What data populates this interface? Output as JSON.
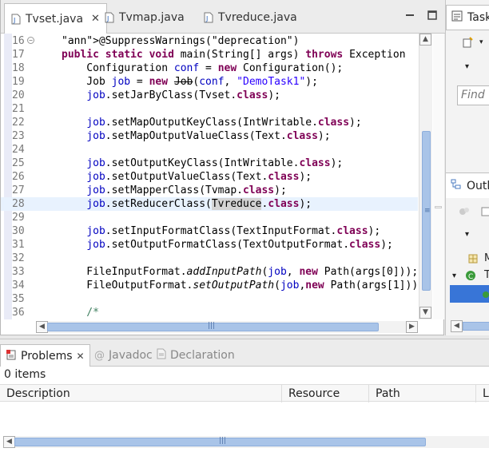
{
  "editor": {
    "tabs": [
      {
        "label": "Tvset.java",
        "active": true,
        "closable": true
      },
      {
        "label": "Tvmap.java",
        "active": false
      },
      {
        "label": "Tvreduce.java",
        "active": false
      }
    ],
    "lines": [
      {
        "n": "16",
        "text": "@SuppressWarnings(\"deprecation\")"
      },
      {
        "n": "17",
        "text": "public static void main(String[] args) throws Exception"
      },
      {
        "n": "18",
        "text": "    Configuration conf = new Configuration();"
      },
      {
        "n": "19",
        "text": "    Job job = new Job(conf, \"DemoTask1\");"
      },
      {
        "n": "20",
        "text": "    job.setJarByClass(Tvset.class);"
      },
      {
        "n": "21",
        "text": ""
      },
      {
        "n": "22",
        "text": "    job.setMapOutputKeyClass(IntWritable.class);"
      },
      {
        "n": "23",
        "text": "    job.setMapOutputValueClass(Text.class);"
      },
      {
        "n": "24",
        "text": ""
      },
      {
        "n": "25",
        "text": "    job.setOutputKeyClass(IntWritable.class);"
      },
      {
        "n": "26",
        "text": "    job.setOutputValueClass(Text.class);"
      },
      {
        "n": "27",
        "text": "    job.setMapperClass(Tvmap.class);"
      },
      {
        "n": "28",
        "text": "    job.setReducerClass(Tvreduce.class);"
      },
      {
        "n": "29",
        "text": ""
      },
      {
        "n": "30",
        "text": "    job.setInputFormatClass(TextInputFormat.class);"
      },
      {
        "n": "31",
        "text": "    job.setOutputFormatClass(TextOutputFormat.class);"
      },
      {
        "n": "32",
        "text": ""
      },
      {
        "n": "33",
        "text": "    FileInputFormat.addInputPath(job, new Path(args[0]));"
      },
      {
        "n": "34",
        "text": "    FileOutputFormat.setOutputPath(job,new Path(args[1]));"
      },
      {
        "n": "35",
        "text": ""
      },
      {
        "n": "36",
        "text": "    /*"
      }
    ],
    "current_line": "28"
  },
  "right": {
    "task_title": "Task",
    "find_placeholder": "Find",
    "outline_title": "Outl",
    "outline_items": [
      "M",
      "T"
    ]
  },
  "bottom": {
    "tabs": [
      {
        "label": "Problems",
        "active": true
      },
      {
        "label": "Javadoc",
        "active": false
      },
      {
        "label": "Declaration",
        "active": false
      }
    ],
    "items_count": "0 items",
    "columns": [
      "Description",
      "Resource",
      "Path",
      "L"
    ]
  },
  "colors": {
    "keyword": "#7f0055",
    "string": "#2a00ff",
    "field": "#0000c0",
    "comment": "#3f7f5f",
    "selection": "#3875d7"
  }
}
